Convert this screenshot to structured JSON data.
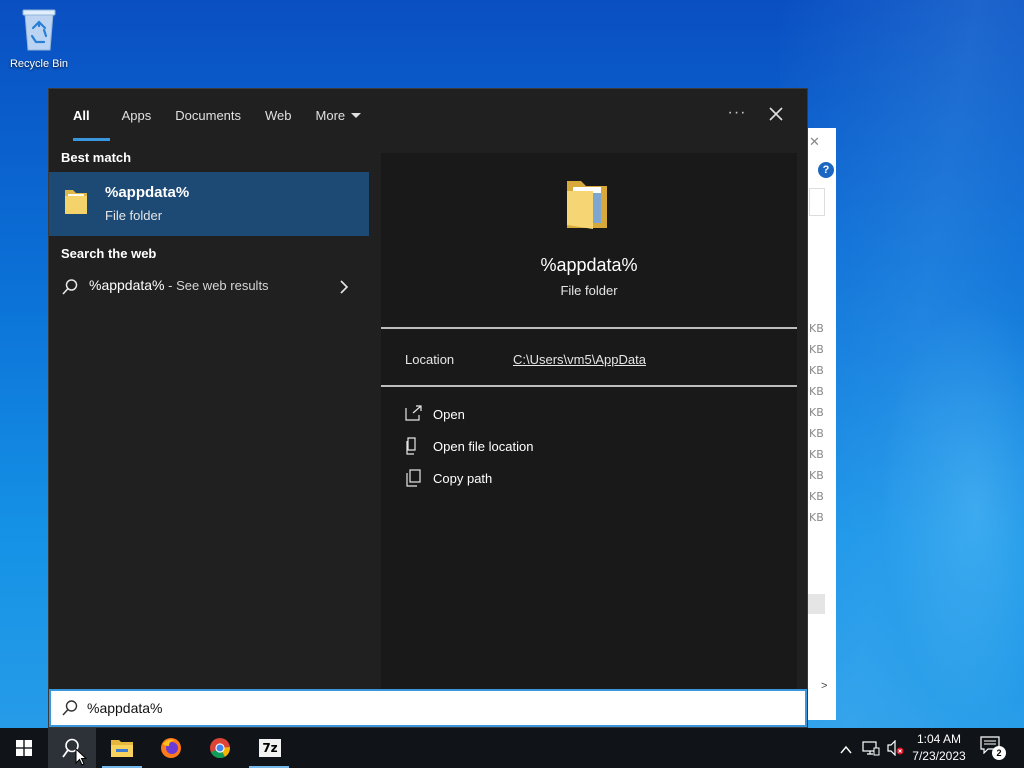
{
  "desktop": {
    "recycle_bin_label": "Recycle Bin"
  },
  "search_panel": {
    "tabs": [
      {
        "label": "All",
        "active": true
      },
      {
        "label": "Apps",
        "active": false
      },
      {
        "label": "Documents",
        "active": false
      },
      {
        "label": "Web",
        "active": false
      },
      {
        "label": "More",
        "active": false
      }
    ],
    "best_match_heading": "Best match",
    "best_match": {
      "name": "%appdata%",
      "type": "File folder"
    },
    "search_web_heading": "Search the web",
    "web_result": {
      "query": "%appdata%",
      "suffix": " - See web results"
    },
    "preview": {
      "name": "%appdata%",
      "type": "File folder",
      "location_label": "Location",
      "location_value": "C:\\Users\\vm5\\AppData",
      "actions": [
        {
          "label": "Open",
          "icon": "open-icon"
        },
        {
          "label": "Open file location",
          "icon": "file-location-icon"
        },
        {
          "label": "Copy path",
          "icon": "copy-icon"
        }
      ]
    },
    "search_box": {
      "value": "%appdata%",
      "icon": "search-icon"
    }
  },
  "background_window": {
    "size_labels": [
      "KB",
      "KB",
      "KB",
      "KB",
      "KB",
      "KB",
      "KB",
      "KB",
      "KB",
      "KB"
    ]
  },
  "taskbar": {
    "apps": [
      {
        "name": "start",
        "icon": "windows-logo-icon"
      },
      {
        "name": "search",
        "icon": "search-icon"
      },
      {
        "name": "file-explorer",
        "icon": "folder-icon"
      },
      {
        "name": "firefox",
        "icon": "firefox-icon"
      },
      {
        "name": "chrome",
        "icon": "chrome-icon"
      },
      {
        "name": "7-zip",
        "icon": "7zip-icon",
        "label": "7z"
      }
    ],
    "clock": {
      "time": "1:04 AM",
      "date": "7/23/2023"
    },
    "notification_count": "2"
  },
  "colors": {
    "accent": "#3a96dd",
    "selected_row": "#1c4a74",
    "panel_bg": "#202020",
    "preview_bg": "#191919",
    "taskbar_bg": "#101418"
  }
}
